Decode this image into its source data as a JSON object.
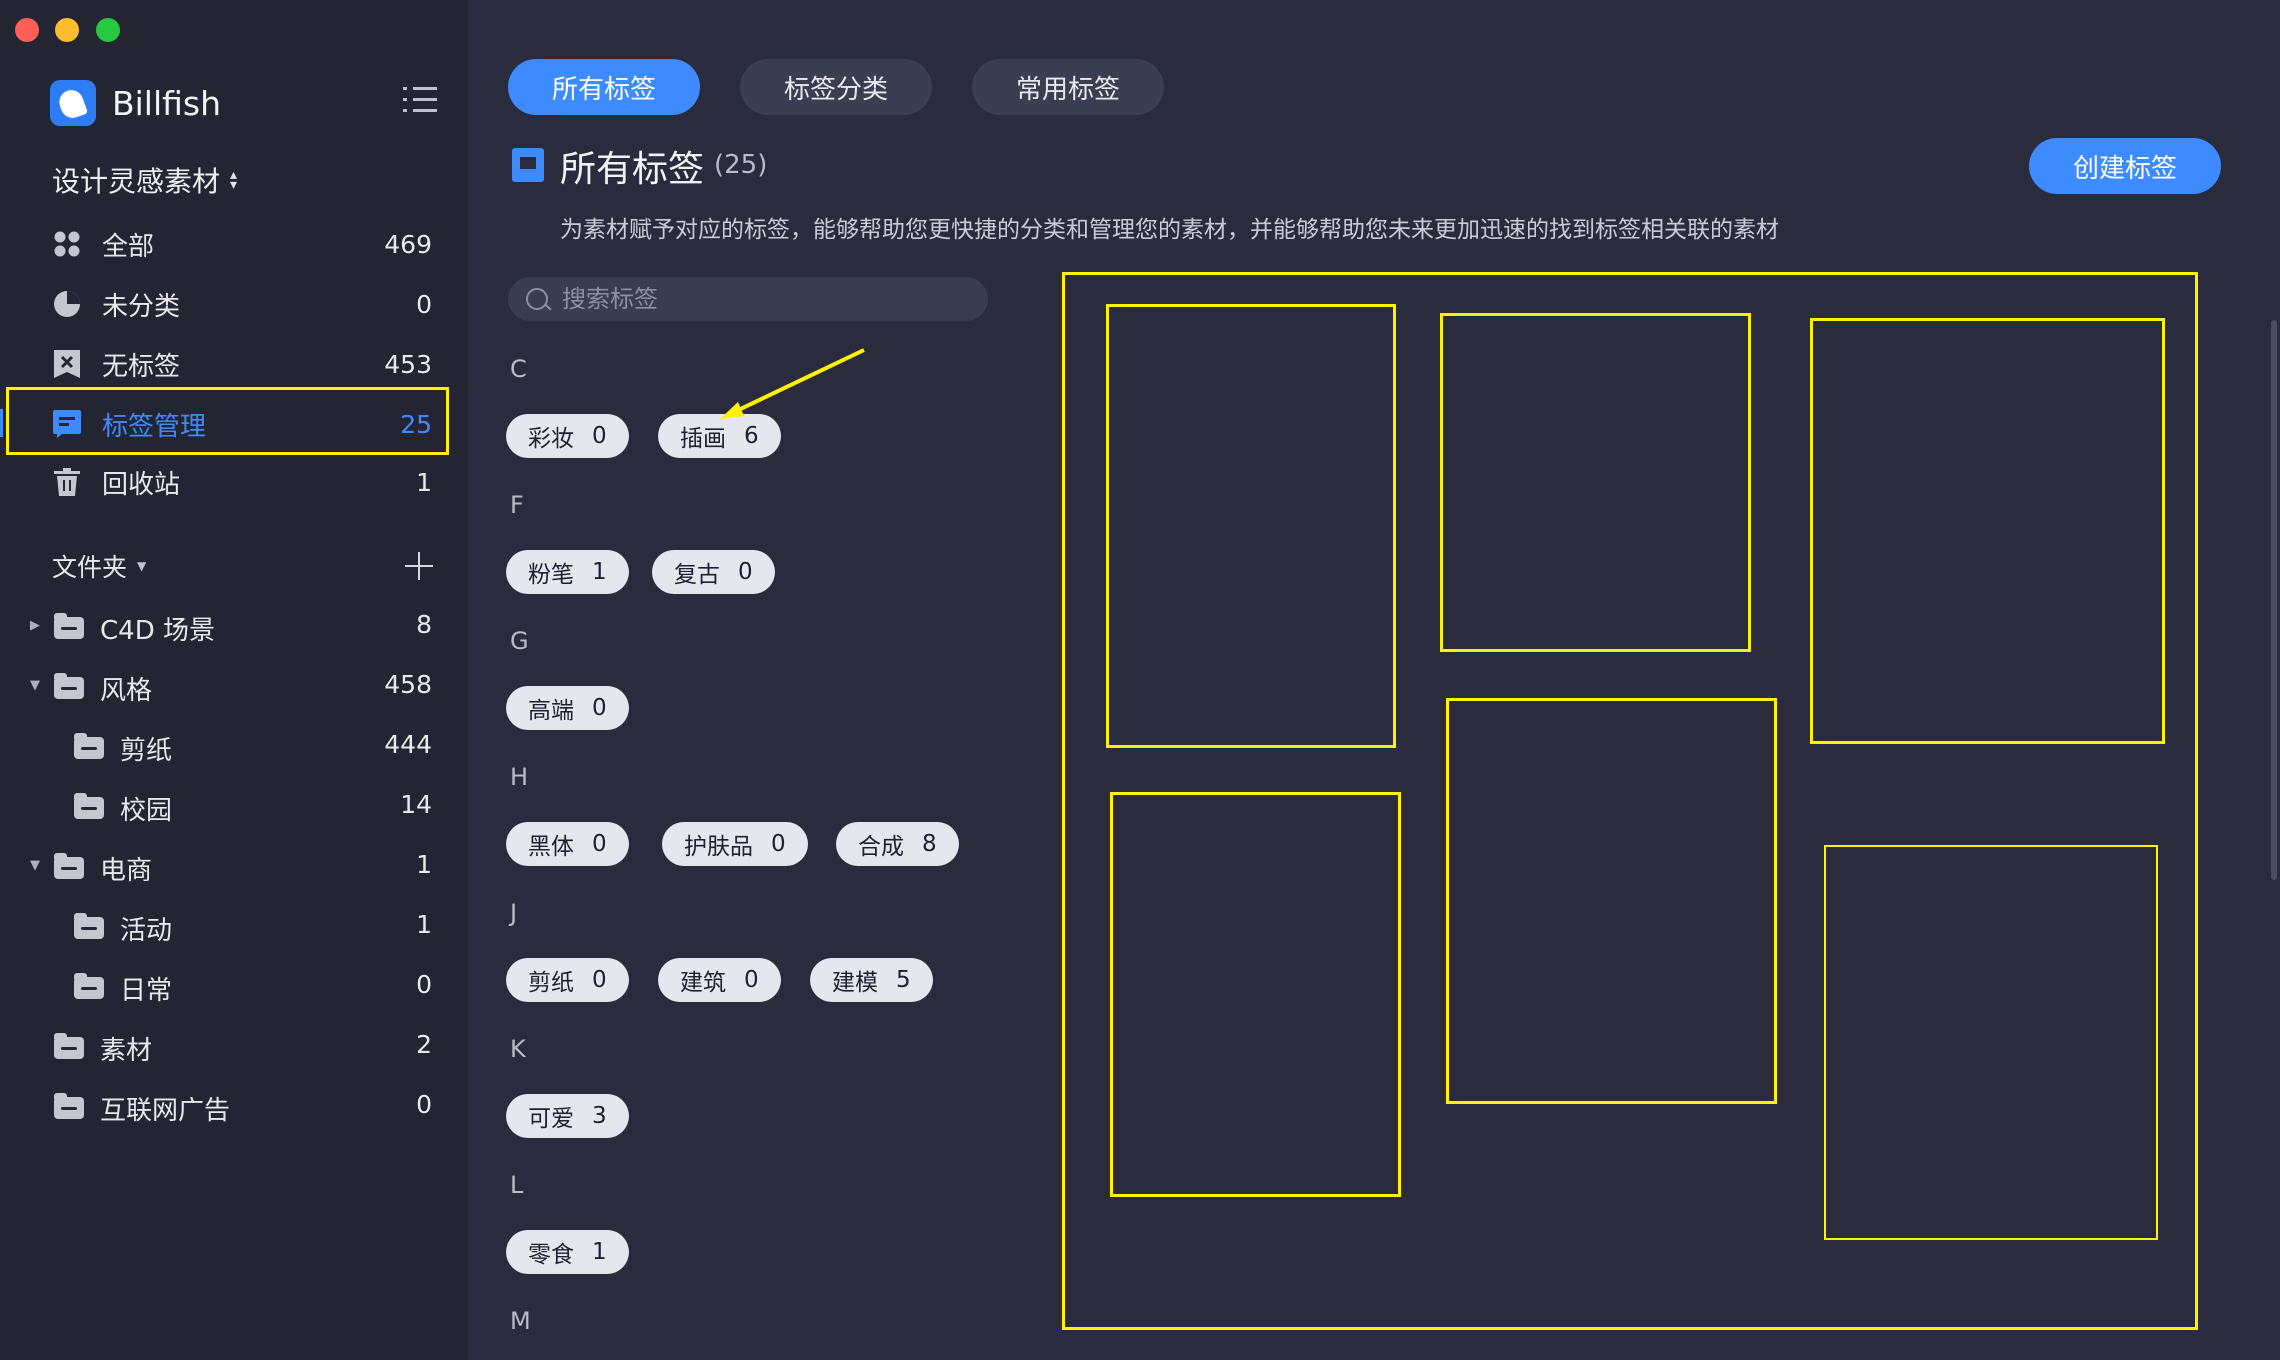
{
  "app": {
    "name": "Billfish"
  },
  "sidebar": {
    "library_name": "设计灵感素材",
    "nav": [
      {
        "label": "全部",
        "count": "469"
      },
      {
        "label": "未分类",
        "count": "0"
      },
      {
        "label": "无标签",
        "count": "453"
      },
      {
        "label": "标签管理",
        "count": "25"
      },
      {
        "label": "回收站",
        "count": "1"
      }
    ],
    "folders_label": "文件夹",
    "folders": [
      {
        "label": "C4D 场景",
        "count": "8"
      },
      {
        "label": "风格",
        "count": "458"
      },
      {
        "label": "剪纸",
        "count": "444"
      },
      {
        "label": "校园",
        "count": "14"
      },
      {
        "label": "电商",
        "count": "1"
      },
      {
        "label": "活动",
        "count": "1"
      },
      {
        "label": "日常",
        "count": "0"
      },
      {
        "label": "素材",
        "count": "2"
      },
      {
        "label": "互联网广告",
        "count": "0"
      }
    ]
  },
  "tabs": [
    {
      "label": "所有标签"
    },
    {
      "label": "标签分类"
    },
    {
      "label": "常用标签"
    }
  ],
  "main": {
    "title": "所有标签",
    "count": "(25)",
    "create_label": "创建标签",
    "description": "为素材赋予对应的标签，能够帮助您更快捷的分类和管理您的素材，并能够帮助您未来更加迅速的找到标签相关联的素材",
    "search_placeholder": "搜索标签"
  },
  "groups": [
    {
      "letter": "C",
      "tags": [
        {
          "name": "彩妆",
          "count": "0"
        },
        {
          "name": "插画",
          "count": "6"
        }
      ]
    },
    {
      "letter": "F",
      "tags": [
        {
          "name": "粉笔",
          "count": "1"
        },
        {
          "name": "复古",
          "count": "0"
        }
      ]
    },
    {
      "letter": "G",
      "tags": [
        {
          "name": "高端",
          "count": "0"
        }
      ]
    },
    {
      "letter": "H",
      "tags": [
        {
          "name": "黑体",
          "count": "0"
        },
        {
          "name": "护肤品",
          "count": "0"
        },
        {
          "name": "合成",
          "count": "8"
        }
      ]
    },
    {
      "letter": "J",
      "tags": [
        {
          "name": "剪纸",
          "count": "0"
        },
        {
          "name": "建筑",
          "count": "0"
        },
        {
          "name": "建模",
          "count": "5"
        }
      ]
    },
    {
      "letter": "K",
      "tags": [
        {
          "name": "可爱",
          "count": "3"
        }
      ]
    },
    {
      "letter": "L",
      "tags": [
        {
          "name": "零食",
          "count": "1"
        }
      ]
    },
    {
      "letter": "M",
      "tags": []
    }
  ],
  "colors": {
    "accent": "#3d8bff",
    "annotation": "#fff200",
    "sidebar_bg": "#232533",
    "main_bg": "#2a2c3d"
  }
}
